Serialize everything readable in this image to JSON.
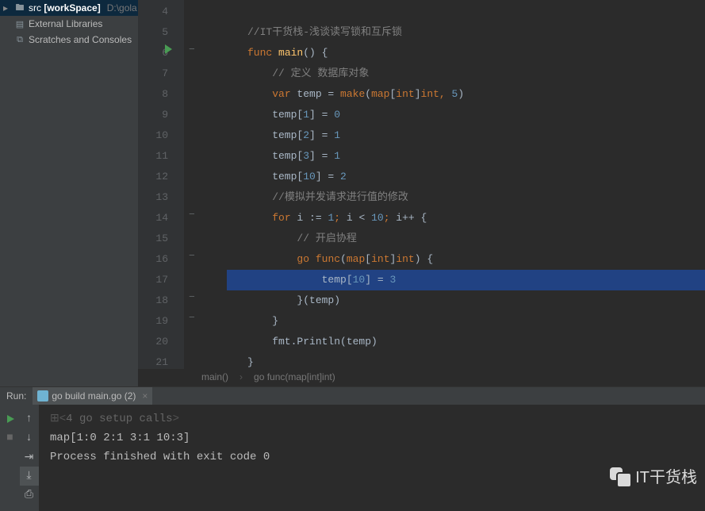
{
  "sidebar": {
    "items": [
      {
        "label": "src [workSpace]",
        "hint": "D:\\gola",
        "icon": "folder-icon",
        "selected": true,
        "interactable": true
      },
      {
        "label": "External Libraries",
        "icon": "library-icon",
        "interactable": true
      },
      {
        "label": "Scratches and Consoles",
        "icon": "scratches-icon",
        "interactable": true
      }
    ]
  },
  "editor": {
    "first_line_number": 4,
    "highlighted_line": 17,
    "run_marker_line": 6,
    "lines": [
      [],
      [
        {
          "t": "//IT干货栈-浅谈读写锁和互斥锁",
          "c": "c-comment"
        }
      ],
      [
        {
          "t": "func ",
          "c": "c-keyword"
        },
        {
          "t": "main",
          "c": "c-funcname"
        },
        {
          "t": "() {",
          "c": "c-plain"
        }
      ],
      [
        {
          "t": "    ",
          "c": "c-plain"
        },
        {
          "t": "// 定义 数据库对象",
          "c": "c-comment"
        }
      ],
      [
        {
          "t": "    ",
          "c": "c-plain"
        },
        {
          "t": "var",
          "c": "c-keyword"
        },
        {
          "t": " temp = ",
          "c": "c-plain"
        },
        {
          "t": "make",
          "c": "c-builtin"
        },
        {
          "t": "(",
          "c": "c-plain"
        },
        {
          "t": "map",
          "c": "c-keyword"
        },
        {
          "t": "[",
          "c": "c-plain"
        },
        {
          "t": "int",
          "c": "c-keyword"
        },
        {
          "t": "]",
          "c": "c-plain"
        },
        {
          "t": "int",
          "c": "c-keyword"
        },
        {
          "t": ", ",
          "c": "c-op"
        },
        {
          "t": "5",
          "c": "c-num"
        },
        {
          "t": ")",
          "c": "c-plain"
        }
      ],
      [
        {
          "t": "    temp[",
          "c": "c-plain"
        },
        {
          "t": "1",
          "c": "c-num"
        },
        {
          "t": "] = ",
          "c": "c-plain"
        },
        {
          "t": "0",
          "c": "c-num"
        }
      ],
      [
        {
          "t": "    temp[",
          "c": "c-plain"
        },
        {
          "t": "2",
          "c": "c-num"
        },
        {
          "t": "] = ",
          "c": "c-plain"
        },
        {
          "t": "1",
          "c": "c-num"
        }
      ],
      [
        {
          "t": "    temp[",
          "c": "c-plain"
        },
        {
          "t": "3",
          "c": "c-num"
        },
        {
          "t": "] = ",
          "c": "c-plain"
        },
        {
          "t": "1",
          "c": "c-num"
        }
      ],
      [
        {
          "t": "    temp[",
          "c": "c-plain"
        },
        {
          "t": "10",
          "c": "c-num"
        },
        {
          "t": "] = ",
          "c": "c-plain"
        },
        {
          "t": "2",
          "c": "c-num"
        }
      ],
      [
        {
          "t": "    ",
          "c": "c-plain"
        },
        {
          "t": "//模拟并发请求进行值的修改",
          "c": "c-comment"
        }
      ],
      [
        {
          "t": "    ",
          "c": "c-plain"
        },
        {
          "t": "for",
          "c": "c-keyword"
        },
        {
          "t": " i := ",
          "c": "c-plain"
        },
        {
          "t": "1",
          "c": "c-num"
        },
        {
          "t": "; ",
          "c": "c-op"
        },
        {
          "t": "i < ",
          "c": "c-plain"
        },
        {
          "t": "10",
          "c": "c-num"
        },
        {
          "t": "; ",
          "c": "c-op"
        },
        {
          "t": "i++ {",
          "c": "c-plain"
        }
      ],
      [
        {
          "t": "        ",
          "c": "c-plain"
        },
        {
          "t": "// 开启协程",
          "c": "c-comment"
        }
      ],
      [
        {
          "t": "        ",
          "c": "c-plain"
        },
        {
          "t": "go",
          "c": "c-keyword"
        },
        {
          "t": " ",
          "c": "c-plain"
        },
        {
          "t": "func",
          "c": "c-keyword"
        },
        {
          "t": "(",
          "c": "c-plain"
        },
        {
          "t": "map",
          "c": "c-keyword"
        },
        {
          "t": "[",
          "c": "c-plain"
        },
        {
          "t": "int",
          "c": "c-keyword"
        },
        {
          "t": "]",
          "c": "c-plain"
        },
        {
          "t": "int",
          "c": "c-keyword"
        },
        {
          "t": ") {",
          "c": "c-plain"
        }
      ],
      [
        {
          "t": "            temp[",
          "c": "c-plain"
        },
        {
          "t": "10",
          "c": "c-num"
        },
        {
          "t": "] = ",
          "c": "c-plain"
        },
        {
          "t": "3",
          "c": "c-num"
        }
      ],
      [
        {
          "t": "        }(temp)",
          "c": "c-plain"
        }
      ],
      [
        {
          "t": "    }",
          "c": "c-plain"
        }
      ],
      [
        {
          "t": "    fmt.Println(temp)",
          "c": "c-plain"
        }
      ],
      [
        {
          "t": "}",
          "c": "c-plain"
        }
      ]
    ]
  },
  "breadcrumbs": {
    "items": [
      "main()",
      "go func(map[int]int)"
    ],
    "sep": "›"
  },
  "run": {
    "label": "Run:",
    "tab": "go build main.go (2)"
  },
  "console": {
    "setup_toggle": "⊞",
    "setup": "4 go setup calls",
    "output": "map[1:0 2:1 3:1 10:3]",
    "blank": "",
    "exit": "Process finished with exit code 0"
  },
  "toolbar": {
    "buttons_left": [
      "rerun-icon",
      "stop-icon"
    ],
    "buttons_right": [
      "up-icon",
      "down-icon",
      "soft-wrap-icon",
      "scroll-to-end-icon",
      "print-icon"
    ]
  },
  "watermark": "IT干货栈"
}
